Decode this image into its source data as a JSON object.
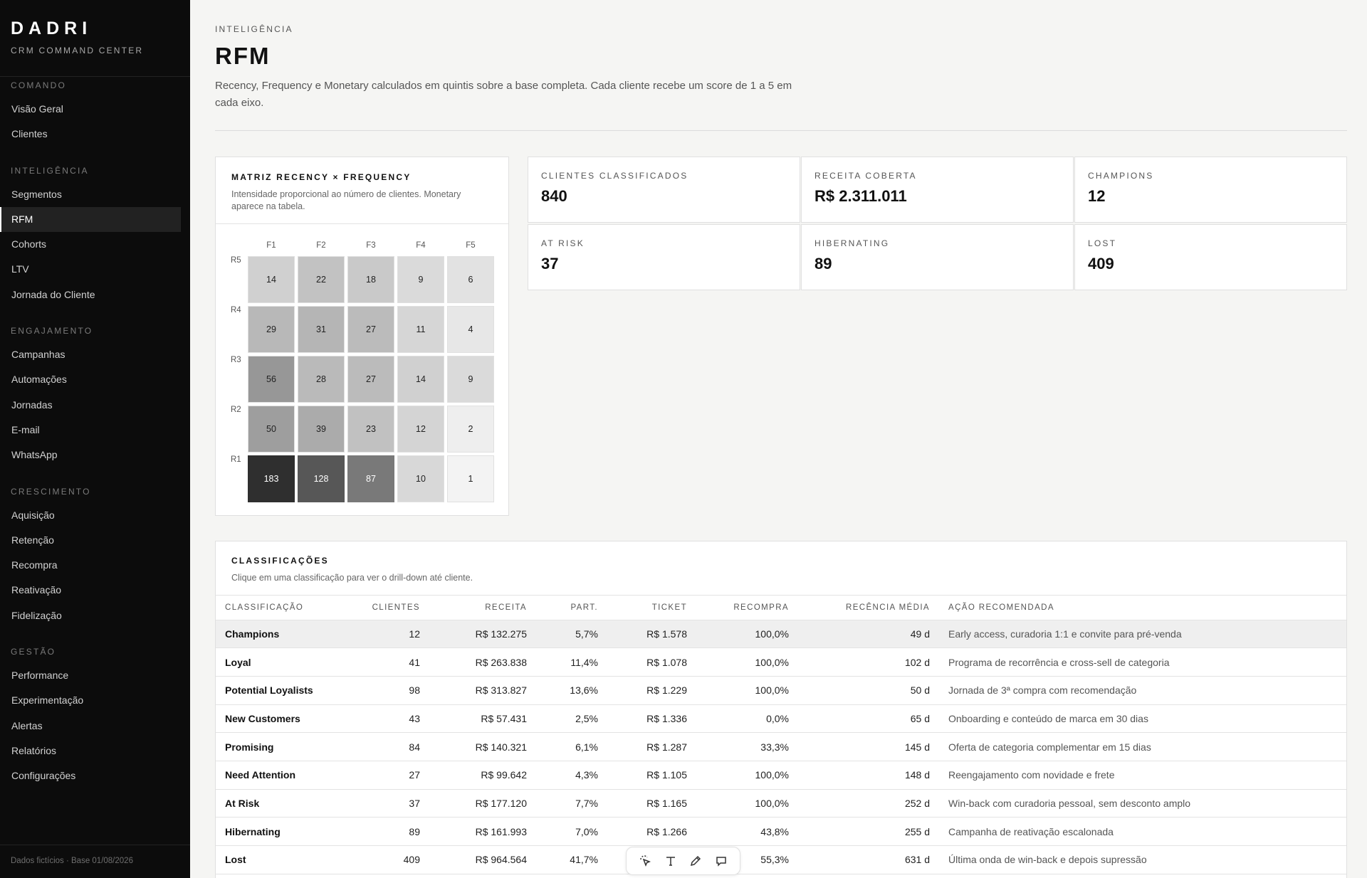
{
  "brand": {
    "name": "DADRI",
    "subtitle": "CRM COMMAND CENTER"
  },
  "sidebar": {
    "sections": [
      {
        "heading": "COMANDO",
        "items": [
          "Visão Geral",
          "Clientes"
        ]
      },
      {
        "heading": "INTELIGÊNCIA",
        "items": [
          "Segmentos",
          "RFM",
          "Cohorts",
          "LTV",
          "Jornada do Cliente"
        ]
      },
      {
        "heading": "ENGAJAMENTO",
        "items": [
          "Campanhas",
          "Automações",
          "Jornadas",
          "E-mail",
          "WhatsApp"
        ]
      },
      {
        "heading": "CRESCIMENTO",
        "items": [
          "Aquisição",
          "Retenção",
          "Recompra",
          "Reativação",
          "Fidelização"
        ]
      },
      {
        "heading": "GESTÃO",
        "items": [
          "Performance",
          "Experimentação",
          "Alertas",
          "Relatórios",
          "Configurações"
        ]
      }
    ],
    "active_item": "RFM",
    "footer": "Dados fictícios · Base 01/08/2026"
  },
  "header": {
    "eyebrow": "INTELIGÊNCIA",
    "title": "RFM",
    "description": "Recency, Frequency e Monetary calculados em quintis sobre a base completa. Cada cliente recebe um score de 1 a 5 em cada eixo."
  },
  "matrix": {
    "title": "MATRIZ RECENCY × FREQUENCY",
    "subtitle": "Intensidade proporcional ao número de clientes. Monetary aparece na tabela.",
    "columns": [
      "F1",
      "F2",
      "F3",
      "F4",
      "F5"
    ],
    "rows": [
      "R5",
      "R4",
      "R3",
      "R2",
      "R1"
    ],
    "values": [
      [
        14,
        22,
        18,
        9,
        6
      ],
      [
        29,
        31,
        27,
        11,
        4
      ],
      [
        56,
        28,
        27,
        14,
        9
      ],
      [
        50,
        39,
        23,
        12,
        2
      ],
      [
        183,
        128,
        87,
        10,
        1
      ]
    ]
  },
  "kpis": [
    {
      "label": "CLIENTES CLASSIFICADOS",
      "value": "840"
    },
    {
      "label": "RECEITA COBERTA",
      "value": "R$ 2.311.011"
    },
    {
      "label": "CHAMPIONS",
      "value": "12"
    },
    {
      "label": "AT RISK",
      "value": "37"
    },
    {
      "label": "HIBERNATING",
      "value": "89"
    },
    {
      "label": "LOST",
      "value": "409"
    }
  ],
  "classifications": {
    "title": "CLASSIFICAÇÕES",
    "subtitle": "Clique em uma classificação para ver o drill-down até cliente.",
    "columns": [
      "CLASSIFICAÇÃO",
      "CLIENTES",
      "RECEITA",
      "PART.",
      "TICKET",
      "RECOMPRA",
      "RECÊNCIA MÉDIA",
      "AÇÃO RECOMENDADA"
    ],
    "rows": [
      {
        "name": "Champions",
        "clientes": "12",
        "receita": "R$ 132.275",
        "part": "5,7%",
        "ticket": "R$ 1.578",
        "recompra": "100,0%",
        "recencia": "49 d",
        "acao": "Early access, curadoria 1:1 e convite para pré-venda"
      },
      {
        "name": "Loyal",
        "clientes": "41",
        "receita": "R$ 263.838",
        "part": "11,4%",
        "ticket": "R$ 1.078",
        "recompra": "100,0%",
        "recencia": "102 d",
        "acao": "Programa de recorrência e cross-sell de categoria"
      },
      {
        "name": "Potential Loyalists",
        "clientes": "98",
        "receita": "R$ 313.827",
        "part": "13,6%",
        "ticket": "R$ 1.229",
        "recompra": "100,0%",
        "recencia": "50 d",
        "acao": "Jornada de 3ª compra com recomendação"
      },
      {
        "name": "New Customers",
        "clientes": "43",
        "receita": "R$ 57.431",
        "part": "2,5%",
        "ticket": "R$ 1.336",
        "recompra": "0,0%",
        "recencia": "65 d",
        "acao": "Onboarding e conteúdo de marca em 30 dias"
      },
      {
        "name": "Promising",
        "clientes": "84",
        "receita": "R$ 140.321",
        "part": "6,1%",
        "ticket": "R$ 1.287",
        "recompra": "33,3%",
        "recencia": "145 d",
        "acao": "Oferta de categoria complementar em 15 dias"
      },
      {
        "name": "Need Attention",
        "clientes": "27",
        "receita": "R$ 99.642",
        "part": "4,3%",
        "ticket": "R$ 1.105",
        "recompra": "100,0%",
        "recencia": "148 d",
        "acao": "Reengajamento com novidade e frete"
      },
      {
        "name": "At Risk",
        "clientes": "37",
        "receita": "R$ 177.120",
        "part": "7,7%",
        "ticket": "R$ 1.165",
        "recompra": "100,0%",
        "recencia": "252 d",
        "acao": "Win-back com curadoria pessoal, sem desconto amplo"
      },
      {
        "name": "Hibernating",
        "clientes": "89",
        "receita": "R$ 161.993",
        "part": "7,0%",
        "ticket": "R$ 1.266",
        "recompra": "43,8%",
        "recencia": "255 d",
        "acao": "Campanha de reativação escalonada"
      },
      {
        "name": "Lost",
        "clientes": "409",
        "receita": "R$ 964.564",
        "part": "41,7%",
        "ticket": "",
        "recompra": "55,3%",
        "recencia": "631 d",
        "acao": "Última onda de win-back e depois supressão"
      }
    ]
  },
  "toolbar": {
    "icons": [
      "select-icon",
      "text-icon",
      "pencil-icon",
      "comment-icon"
    ]
  }
}
